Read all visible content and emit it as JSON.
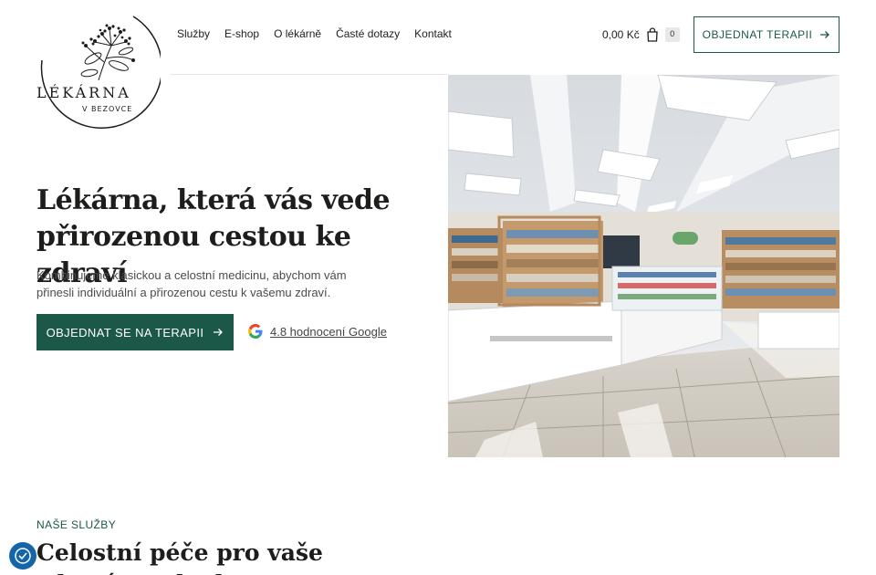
{
  "logo": {
    "name": "LÉKÁRNA",
    "subtitle": "V BEZOVCE"
  },
  "nav": {
    "items": [
      {
        "label": "Služby"
      },
      {
        "label": "E-shop"
      },
      {
        "label": "O lékárně"
      },
      {
        "label": "Časté dotazy"
      },
      {
        "label": "Kontakt"
      }
    ]
  },
  "cart": {
    "price": "0,00 Kč",
    "count": "0",
    "icon": "shopping-bag-icon"
  },
  "header_cta": {
    "label": "OBJEDNAT TERAPII",
    "icon": "arrow-right-icon"
  },
  "hero": {
    "title": "Lékárna, která vás vede přirozenou cestou ke zdraví",
    "text": "Kombinujeme klasickou a celostní medicinu, abychom vám přinesli individuální a přirozenou cestu k vašemu zdraví.",
    "cta_label": "OBJEDNAT SE NA TERAPII",
    "cta_icon": "arrow-right-icon",
    "rating_text": "4.8 hodnocení Google",
    "rating_icon": "google-icon"
  },
  "services": {
    "label": "NAŠE SLUŽBY",
    "title": "Celostní péče pro vaše zdraví a pohodu"
  },
  "cookie": {
    "icon": "cookie-settings-icon"
  },
  "colors": {
    "accent": "#1b5848",
    "text": "#1d1d1b",
    "muted": "#4b4b4b",
    "cookie": "#1565a8"
  }
}
